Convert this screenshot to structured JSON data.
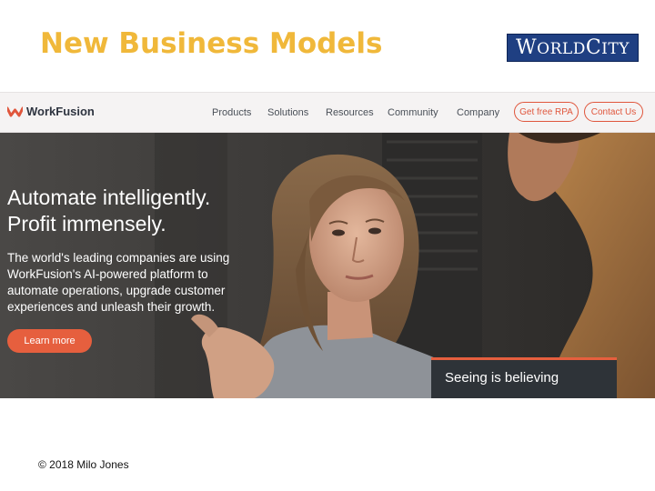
{
  "slide": {
    "title": "New Business Models",
    "footer": "© 2018 Milo Jones"
  },
  "brand_logo": {
    "text_big_w": "W",
    "text_orld": "ORLD",
    "text_big_c": "C",
    "text_ity": "ITY",
    "bg_color": "#1f3f82"
  },
  "site": {
    "logo_text": "WorkFusion",
    "nav_links": [
      "Products",
      "Solutions",
      "Resources",
      "Community",
      "Company"
    ],
    "cta_primary": "Get free RPA",
    "cta_secondary": "Contact Us",
    "accent_color": "#e65f3e",
    "hero": {
      "heading_line1": "Automate intelligently.",
      "heading_line2": "Profit immensely.",
      "body_lines": [
        "The world's leading companies are using",
        "WorkFusion's AI-powered platform to",
        "automate operations, upgrade customer",
        "experiences and unleash their growth."
      ],
      "button_label": "Learn more",
      "video_caption": "Seeing is believing"
    }
  }
}
